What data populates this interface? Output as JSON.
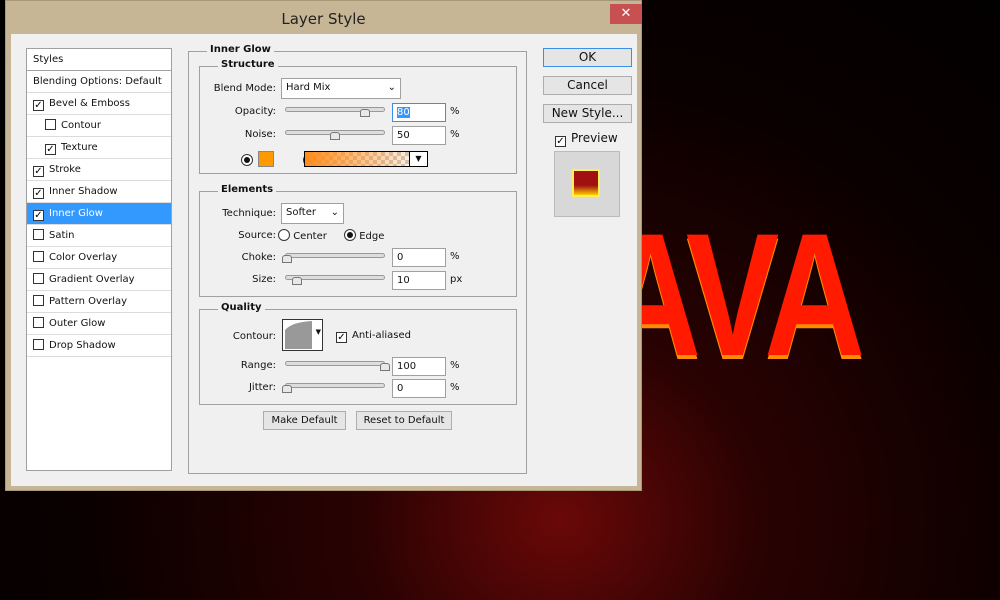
{
  "canvas": {
    "text": "AVA"
  },
  "dialog": {
    "title": "Layer Style",
    "close": "✕"
  },
  "styles_list": {
    "items": [
      {
        "label": "Styles",
        "checkbox": false
      },
      {
        "label": "Blending Options: Default",
        "checkbox": false
      },
      {
        "label": "Bevel & Emboss",
        "checked": true
      },
      {
        "label": "Contour",
        "checked": false,
        "indent": true
      },
      {
        "label": "Texture",
        "checked": true,
        "indent": true
      },
      {
        "label": "Stroke",
        "checked": true
      },
      {
        "label": "Inner Shadow",
        "checked": true
      },
      {
        "label": "Inner Glow",
        "checked": true,
        "selected": true
      },
      {
        "label": "Satin",
        "checked": false
      },
      {
        "label": "Color Overlay",
        "checked": false
      },
      {
        "label": "Gradient Overlay",
        "checked": false
      },
      {
        "label": "Pattern Overlay",
        "checked": false
      },
      {
        "label": "Outer Glow",
        "checked": false
      },
      {
        "label": "Drop Shadow",
        "checked": false
      }
    ]
  },
  "panel": {
    "title": "Inner Glow",
    "structure": {
      "title": "Structure",
      "blend_mode_label": "Blend Mode:",
      "blend_mode": "Hard Mix",
      "opacity_label": "Opacity:",
      "opacity": "80",
      "noise_label": "Noise:",
      "noise": "50",
      "percent": "%",
      "glow_color": "#ff9900"
    },
    "elements": {
      "title": "Elements",
      "technique_label": "Technique:",
      "technique": "Softer",
      "source_label": "Source:",
      "source_center": "Center",
      "source_edge": "Edge",
      "choke_label": "Choke:",
      "choke": "0",
      "size_label": "Size:",
      "size": "10",
      "percent": "%",
      "px": "px"
    },
    "quality": {
      "title": "Quality",
      "contour_label": "Contour:",
      "anti_aliased": "Anti-aliased",
      "range_label": "Range:",
      "range": "100",
      "jitter_label": "Jitter:",
      "jitter": "0",
      "percent": "%"
    },
    "make_default": "Make Default",
    "reset_default": "Reset to Default"
  },
  "buttons": {
    "ok": "OK",
    "cancel": "Cancel",
    "new_style": "New Style...",
    "preview": "Preview"
  }
}
